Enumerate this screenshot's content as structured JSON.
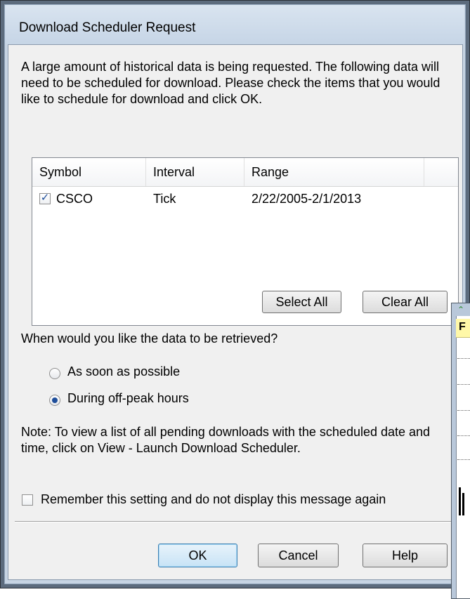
{
  "window": {
    "title": "Download Scheduler Request"
  },
  "message": "A large amount of historical data is being requested.  The following data will need to be scheduled for download.  Please check the items that you would like to schedule for download and click OK.",
  "list": {
    "columns": [
      "Symbol",
      "Interval",
      "Range"
    ],
    "rows": [
      {
        "checked": true,
        "symbol": "CSCO",
        "interval": "Tick",
        "range": "2/22/2005-2/1/2013"
      }
    ]
  },
  "buttons": {
    "select_all": "Select All",
    "clear_all": "Clear All",
    "ok": "OK",
    "cancel": "Cancel",
    "help": "Help"
  },
  "retrieval": {
    "question": "When would you like the data to be retrieved?",
    "options": [
      "As soon as possible",
      "During off-peak hours"
    ],
    "selected": "During off-peak hours"
  },
  "note": "Note:  To view a list of all pending downloads with the scheduled date and time, click on View - Launch Download Scheduler.",
  "remember": {
    "label": "Remember this setting and do not display this message again",
    "checked": false
  },
  "background_window": {
    "header_letter": "F"
  },
  "colors": {
    "titlebar": "#c6d5e6",
    "radio_selected": "#1f4e9a",
    "default_button_border": "#3c7fb1"
  }
}
